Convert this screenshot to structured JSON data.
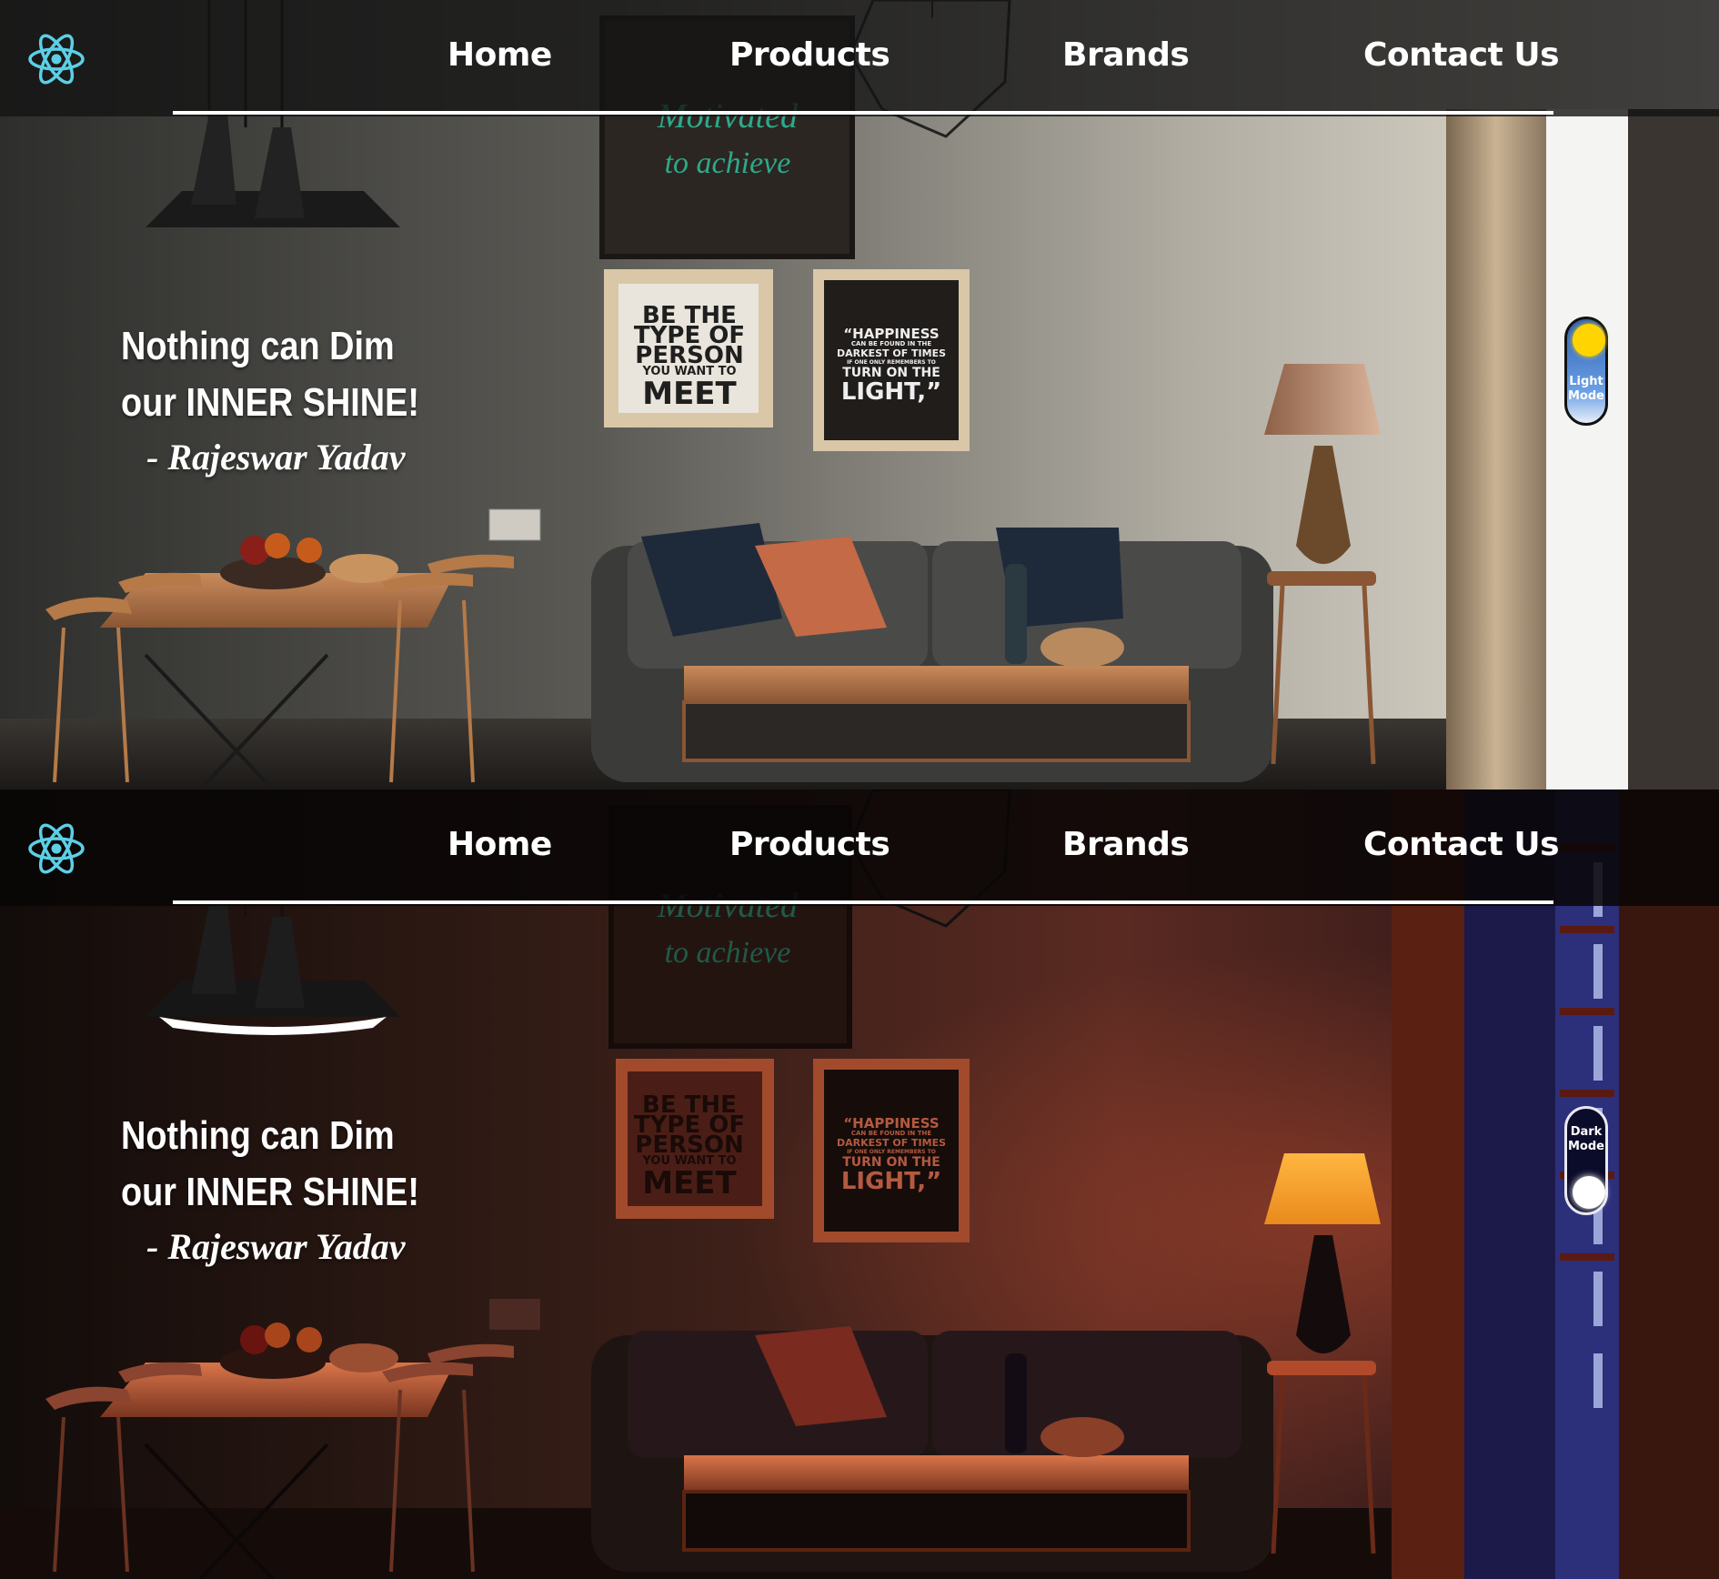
{
  "nav": {
    "links": [
      "Home",
      "Products",
      "Brands",
      "Contact Us"
    ]
  },
  "hero": {
    "quote_line1": "Nothing can Dim",
    "quote_line2": "our INNER SHINE!",
    "author": "- Rajeswar Yadav"
  },
  "light_panel": {
    "toggle_label_1": "Light",
    "toggle_label_2": "Mode",
    "poster_1": [
      "BE THE",
      "TYPE OF",
      "PERSON",
      "YOU WANT TO",
      "MEET"
    ],
    "poster_2": [
      "“HAPPINESS",
      "CAN BE FOUND IN THE",
      "DARKEST OF TIMES",
      "IF ONE ONLY REMEMBERS TO",
      "TURN ON THE",
      "LIGHT,”"
    ]
  },
  "dark_panel": {
    "toggle_label_1": "Dark",
    "toggle_label_2": "Mode",
    "poster_1": [
      "BE THE",
      "TYPE OF",
      "PERSON",
      "YOU WANT TO",
      "MEET"
    ],
    "poster_2": [
      "“HAPPINESS",
      "CAN BE FOUND IN THE",
      "DARKEST OF TIMES",
      "IF ONE ONLY REMEMBERS TO",
      "TURN ON THE",
      "LIGHT,”"
    ]
  },
  "colors": {
    "logo": "#5ccfe6",
    "sun": "#ffd400",
    "toggle_light": "#3a7bd5",
    "toggle_dark": "#0b0b2a"
  }
}
